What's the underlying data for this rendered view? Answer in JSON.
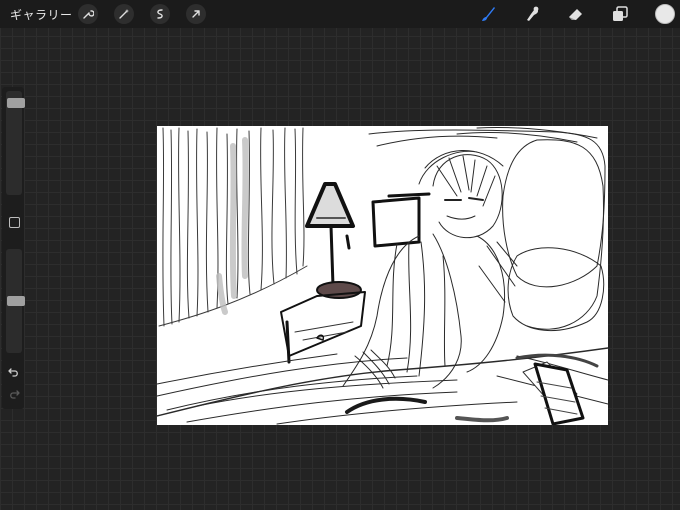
{
  "topbar": {
    "gallery_label": "ギャラリー",
    "left_tools": [
      "wrench-icon",
      "magic-wand-icon",
      "selection-icon",
      "transform-arrow-icon"
    ],
    "right_tools": [
      "brush-icon",
      "smudge-icon",
      "eraser-icon",
      "layers-icon",
      "color-swatch"
    ],
    "active_tool": "brush",
    "active_color": "#e8e8e8",
    "accent": "#2f7bf5"
  },
  "sidebar": {
    "brush_size_level": 0.05,
    "opacity_level": 0.5,
    "icons": [
      "modify-square-icon",
      "undo-icon",
      "redo-icon"
    ]
  },
  "canvas": {
    "background": "#ffffff",
    "content": "pencil-sketch-artwork"
  }
}
